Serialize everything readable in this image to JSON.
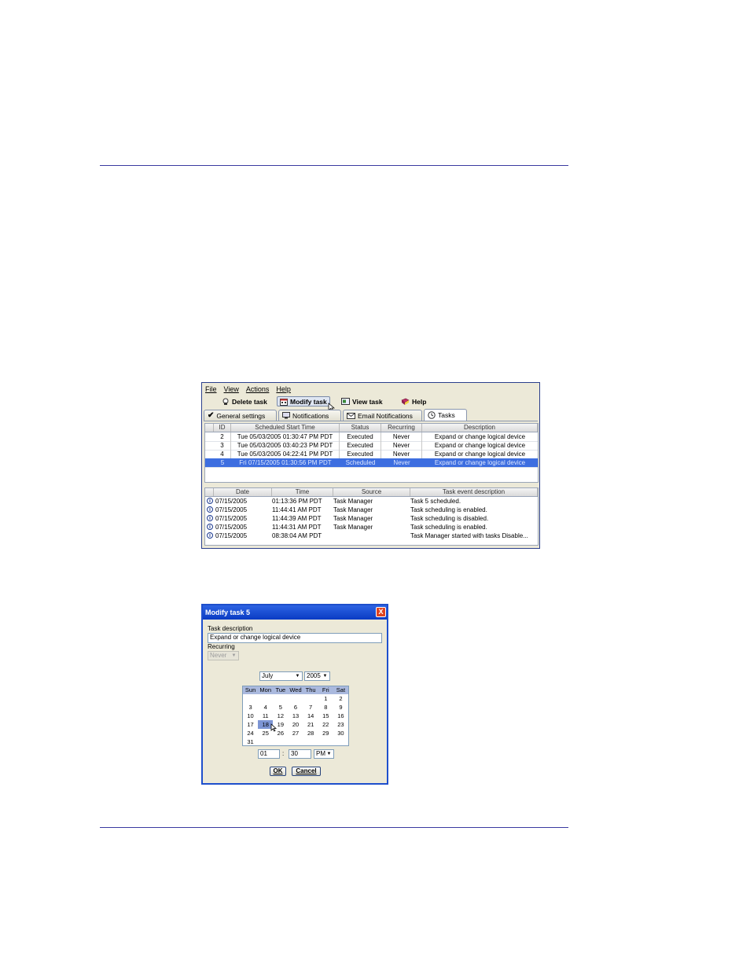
{
  "menus": [
    "File",
    "View",
    "Actions",
    "Help"
  ],
  "toolbar": {
    "delete_label": "Delete task",
    "modify_label": "Modify task",
    "view_label": "View task",
    "help_label": "Help"
  },
  "tabs": [
    "General settings",
    "Notifications",
    "Email Notifications",
    "Tasks"
  ],
  "tasks": {
    "columns": [
      "ID",
      "Scheduled Start Time",
      "Status",
      "Recurring",
      "Description"
    ],
    "rows": [
      {
        "id": "2",
        "time": "Tue 05/03/2005 01:30:47 PM PDT",
        "status": "Executed",
        "recurring": "Never",
        "description": "Expand or change logical device"
      },
      {
        "id": "3",
        "time": "Tue 05/03/2005 03:40:23 PM PDT",
        "status": "Executed",
        "recurring": "Never",
        "description": "Expand or change logical device"
      },
      {
        "id": "4",
        "time": "Tue 05/03/2005 04:22:41 PM PDT",
        "status": "Executed",
        "recurring": "Never",
        "description": "Expand or change logical device"
      },
      {
        "id": "5",
        "time": "Fri 07/15/2005 01:30:56 PM PDT",
        "status": "Scheduled",
        "recurring": "Never",
        "description": "Expand or change logical device"
      }
    ]
  },
  "events": {
    "columns": [
      "Date",
      "Time",
      "Source",
      "Task event description"
    ],
    "rows": [
      {
        "date": "07/15/2005",
        "time": "01:13:36 PM PDT",
        "source": "Task Manager",
        "description": "Task 5 scheduled."
      },
      {
        "date": "07/15/2005",
        "time": "11:44:41 AM PDT",
        "source": "Task Manager",
        "description": "Task scheduling is enabled."
      },
      {
        "date": "07/15/2005",
        "time": "11:44:39 AM PDT",
        "source": "Task Manager",
        "description": "Task scheduling is disabled."
      },
      {
        "date": "07/15/2005",
        "time": "11:44:31 AM PDT",
        "source": "Task Manager",
        "description": "Task scheduling is enabled."
      },
      {
        "date": "07/15/2005",
        "time": "08:38:04 AM PDT",
        "source": "",
        "description": "Task Manager started with tasks Disable..."
      }
    ]
  },
  "dialog": {
    "title": "Modify task 5",
    "close": "X",
    "desc_label": "Task description",
    "desc_value": "Expand or change logical device",
    "recurring_label": "Recurring",
    "recurring_value": "Never",
    "month": "July",
    "year": "2005",
    "days_header": [
      "Sun",
      "Mon",
      "Tue",
      "Wed",
      "Thu",
      "Fri",
      "Sat"
    ],
    "weeks": [
      [
        "",
        "",
        "",
        "",
        "",
        "1",
        "2"
      ],
      [
        "3",
        "4",
        "5",
        "6",
        "7",
        "8",
        "9"
      ],
      [
        "10",
        "11",
        "12",
        "13",
        "14",
        "15",
        "16"
      ],
      [
        "17",
        "18",
        "19",
        "20",
        "21",
        "22",
        "23"
      ],
      [
        "24",
        "25",
        "26",
        "27",
        "28",
        "29",
        "30"
      ],
      [
        "31",
        "",
        "",
        "",
        "",
        "",
        ""
      ]
    ],
    "selected_day": "18",
    "hour": "01",
    "separator": ":",
    "minute": "30",
    "ampm": "PM",
    "ok_label": "OK",
    "cancel_label": "Cancel"
  }
}
